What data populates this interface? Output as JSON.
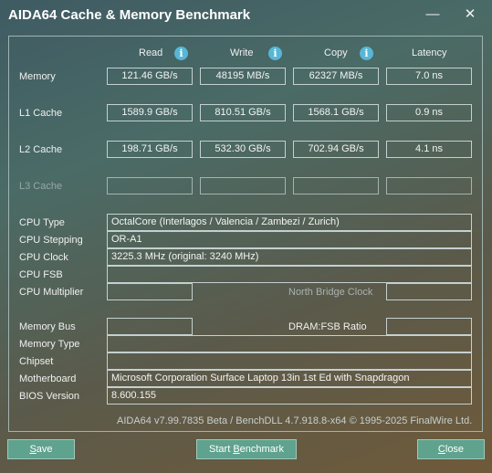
{
  "window": {
    "title": "AIDA64 Cache & Memory Benchmark",
    "minimize_glyph": "—",
    "close_glyph": "✕"
  },
  "headers": {
    "read": "Read",
    "write": "Write",
    "copy": "Copy",
    "latency": "Latency"
  },
  "info_icon_glyph": "i",
  "rows": {
    "memory": {
      "label": "Memory",
      "read": "121.46 GB/s",
      "write": "48195 MB/s",
      "copy": "62327 MB/s",
      "latency": "7.0 ns"
    },
    "l1": {
      "label": "L1 Cache",
      "read": "1589.9 GB/s",
      "write": "810.51 GB/s",
      "copy": "1568.1 GB/s",
      "latency": "0.9 ns"
    },
    "l2": {
      "label": "L2 Cache",
      "read": "198.71 GB/s",
      "write": "532.30 GB/s",
      "copy": "702.94 GB/s",
      "latency": "4.1 ns"
    },
    "l3": {
      "label": "L3 Cache",
      "read": "",
      "write": "",
      "copy": "",
      "latency": ""
    }
  },
  "cpu": {
    "type_label": "CPU Type",
    "type_value": "OctalCore   (Interlagos / Valencia / Zambezi / Zurich)",
    "stepping_label": "CPU Stepping",
    "stepping_value": "OR-A1",
    "clock_label": "CPU Clock",
    "clock_value": "3225.3 MHz  (original: 3240 MHz)",
    "fsb_label": "CPU FSB",
    "fsb_value": "",
    "multiplier_label": "CPU Multiplier",
    "multiplier_value": "",
    "nb_clock_label": "North Bridge Clock",
    "nb_clock_value": ""
  },
  "memory_info": {
    "bus_label": "Memory Bus",
    "bus_value": "",
    "dram_fsb_label": "DRAM:FSB Ratio",
    "dram_fsb_value": "",
    "type_label": "Memory Type",
    "type_value": "",
    "chipset_label": "Chipset",
    "chipset_value": "",
    "motherboard_label": "Motherboard",
    "motherboard_value": "Microsoft Corporation Surface Laptop 13in 1st Ed with Snapdragon",
    "bios_label": "BIOS Version",
    "bios_value": "8.600.155"
  },
  "footer": "AIDA64 v7.99.7835 Beta / BenchDLL 4.7.918.8-x64 © 1995-2025 FinalWire Ltd.",
  "buttons": {
    "save_underlined": "S",
    "save_rest": "ave",
    "start_pre": "Start ",
    "start_underlined": "B",
    "start_rest": "enchmark",
    "close_underlined": "C",
    "close_rest": "lose"
  }
}
